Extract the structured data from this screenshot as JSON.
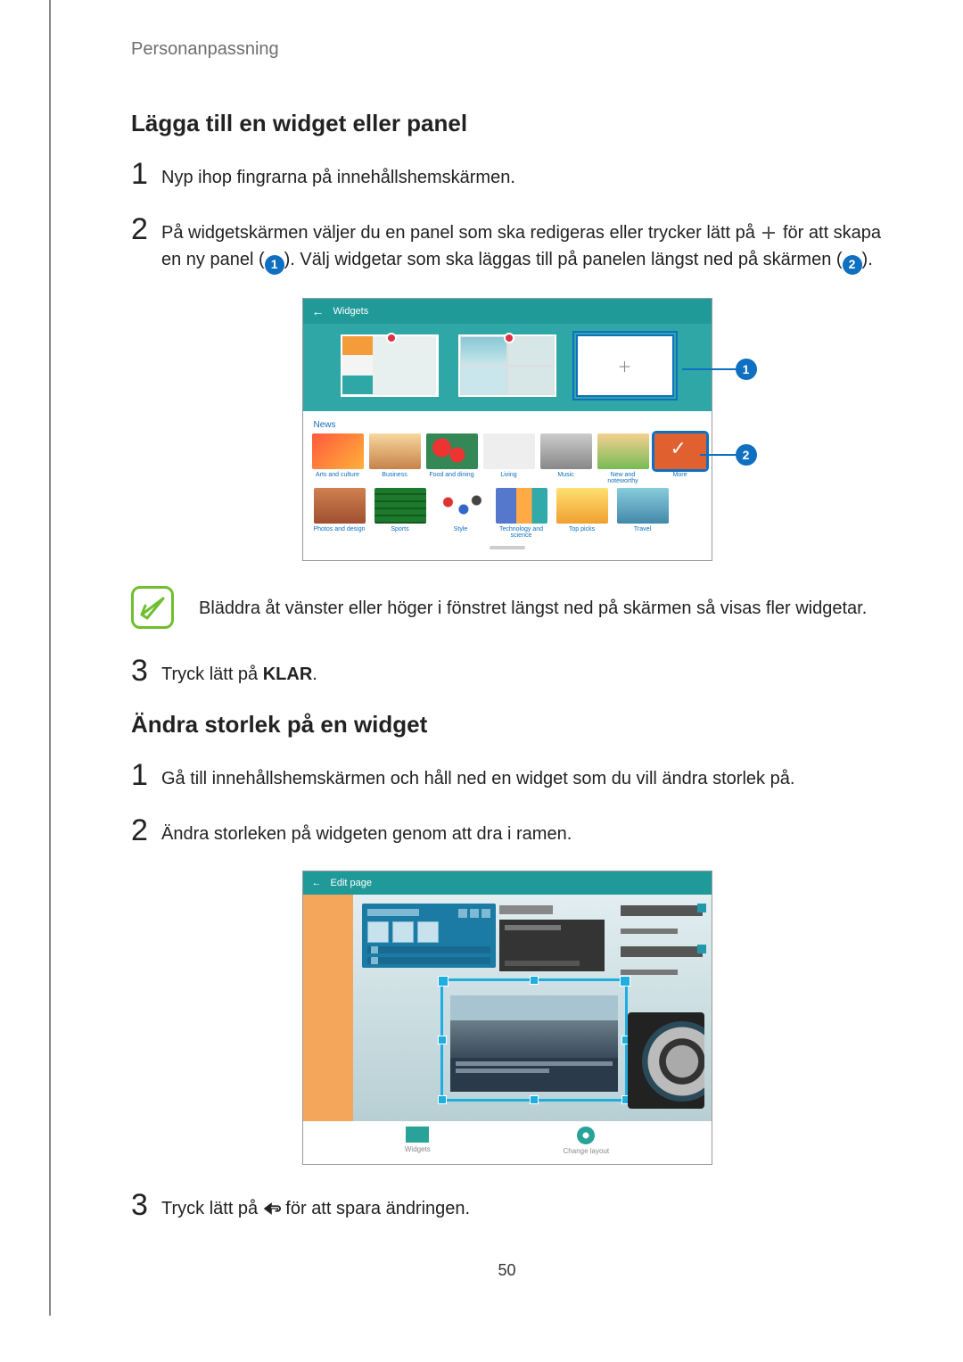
{
  "breadcrumb": "Personanpassning",
  "page_number": "50",
  "section1": {
    "title": "Lägga till en widget eller panel",
    "step1_num": "1",
    "step1_text": "Nyp ihop fingrarna på innehållshemskärmen.",
    "step2_num": "2",
    "step2_text_a": "På widgetskärmen väljer du en panel som ska redigeras eller trycker lätt på ",
    "step2_text_b": " för att skapa en ny panel (",
    "step2_badge1": "1",
    "step2_text_c": "). Välj widgetar som ska läggas till på panelen längst ned på skärmen (",
    "step2_badge2": "2",
    "step2_text_d": ").",
    "callout1": "1",
    "callout2": "2",
    "fig1": {
      "toolbar_arrow": "←",
      "toolbar_title": "Widgets",
      "grid_caption": "News",
      "plus_glyph": "＋",
      "items_row1": [
        "Arts and culture",
        "Business",
        "Food and dining",
        "Living",
        "Music",
        "New and noteworthy",
        "More"
      ],
      "items_row2": [
        "Photos and design",
        "Sports",
        "Style",
        "Technology and science",
        "Top picks",
        "Travel"
      ]
    },
    "note_text": "Bläddra åt vänster eller höger i fönstret längst ned på skärmen så visas fler widgetar.",
    "step3_num": "3",
    "step3_text_a": "Tryck lätt på ",
    "step3_bold": "KLAR",
    "step3_text_b": "."
  },
  "section2": {
    "title": "Ändra storlek på en widget",
    "step1_num": "1",
    "step1_text": "Gå till innehållshemskärmen och håll ned en widget som du vill ändra storlek på.",
    "step2_num": "2",
    "step2_text": "Ändra storleken på widgeten genom att dra i ramen.",
    "fig2": {
      "toolbar_arrow": "←",
      "toolbar_title": "Edit page",
      "bottom_left": "Widgets",
      "bottom_right": "Change layout"
    },
    "step3_num": "3",
    "step3_text_a": "Tryck lätt på ",
    "step3_text_b": " för att spara ändringen."
  }
}
